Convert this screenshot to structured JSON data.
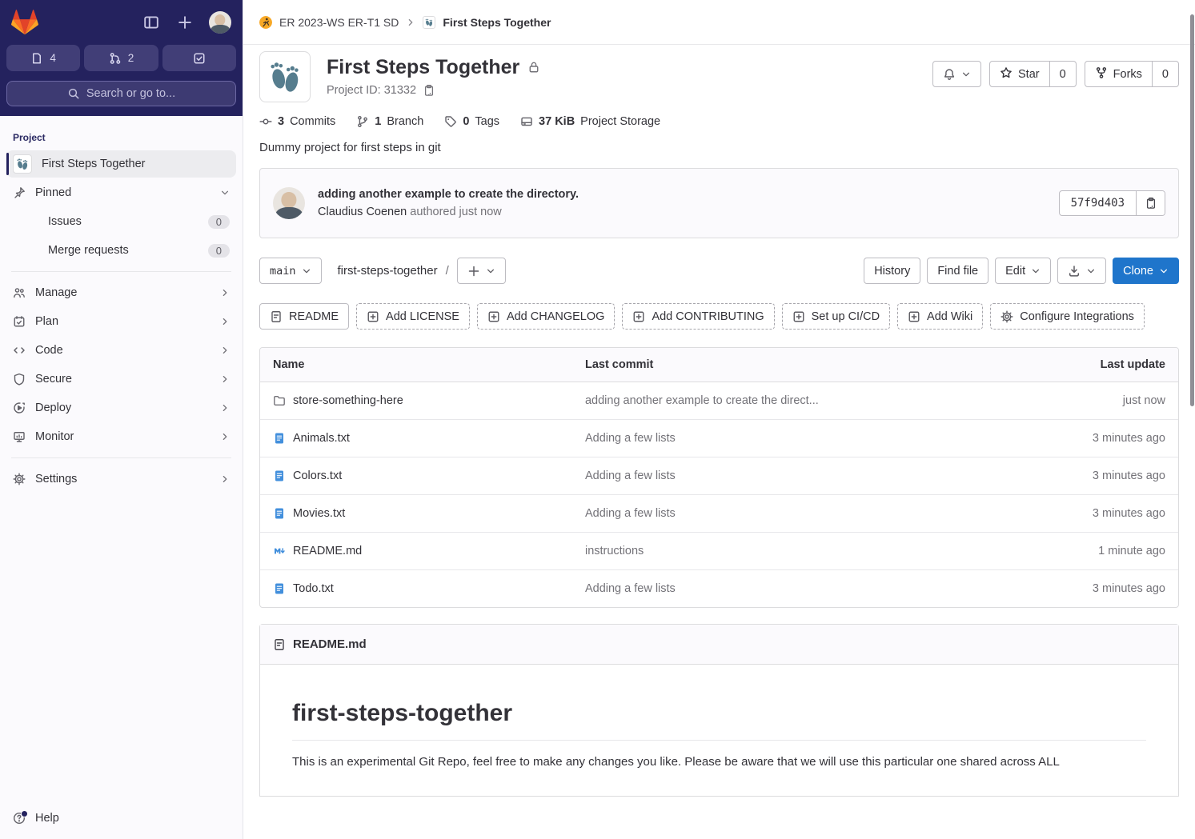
{
  "topbar": {
    "issues_count": "4",
    "mr_count": "2",
    "search_placeholder": "Search or go to..."
  },
  "sidebar": {
    "section_label": "Project",
    "project": "First Steps Together",
    "pinned": "Pinned",
    "pinned_items": [
      {
        "label": "Issues",
        "count": "0"
      },
      {
        "label": "Merge requests",
        "count": "0"
      }
    ],
    "items": [
      "Manage",
      "Plan",
      "Code",
      "Secure",
      "Deploy",
      "Monitor",
      "Settings"
    ],
    "help": "Help"
  },
  "breadcrumb": {
    "group": "ER 2023-WS ER-T1 SD",
    "project": "First Steps Together"
  },
  "project": {
    "title": "First Steps Together",
    "id_label": "Project ID: 31332",
    "description": "Dummy project for first steps in git"
  },
  "head_actions": {
    "star_label": "Star",
    "star_count": "0",
    "forks_label": "Forks",
    "forks_count": "0"
  },
  "stats": [
    {
      "value": "3",
      "label": "Commits"
    },
    {
      "value": "1",
      "label": "Branch"
    },
    {
      "value": "0",
      "label": "Tags"
    },
    {
      "value": "37 KiB",
      "label": "Project Storage"
    }
  ],
  "commit": {
    "message": "adding another example to create the directory.",
    "author": "Claudius Coenen",
    "meta": "authored just now",
    "sha": "57f9d403"
  },
  "controls": {
    "branch": "main",
    "path": "first-steps-together",
    "separator": "/",
    "history": "History",
    "find_file": "Find file",
    "edit": "Edit",
    "clone": "Clone"
  },
  "quick_actions": [
    "README",
    "Add LICENSE",
    "Add CHANGELOG",
    "Add CONTRIBUTING",
    "Set up CI/CD",
    "Add Wiki",
    "Configure Integrations"
  ],
  "tree": {
    "headers": {
      "name": "Name",
      "commit": "Last commit",
      "update": "Last update"
    },
    "rows": [
      {
        "name": "store-something-here",
        "commit": "adding another example to create the direct...",
        "updated": "just now"
      },
      {
        "name": "Animals.txt",
        "commit": "Adding a few lists",
        "updated": "3 minutes ago"
      },
      {
        "name": "Colors.txt",
        "commit": "Adding a few lists",
        "updated": "3 minutes ago"
      },
      {
        "name": "Movies.txt",
        "commit": "Adding a few lists",
        "updated": "3 minutes ago"
      },
      {
        "name": "README.md",
        "commit": "instructions",
        "updated": "1 minute ago"
      },
      {
        "name": "Todo.txt",
        "commit": "Adding a few lists",
        "updated": "3 minutes ago"
      }
    ]
  },
  "readme": {
    "filename": "README.md",
    "title": "first-steps-together",
    "body": "This is an experimental Git Repo, feel free to make any changes you like. Please be aware that we will use this particular one shared across ALL"
  },
  "colors": {
    "accent_blue": "#1f75cb",
    "sidebar_dark": "#24225e",
    "brand_orange": "#fc6d26",
    "file_icon_blue": "#428fdc",
    "avatar_footprints": "#567d8e"
  }
}
